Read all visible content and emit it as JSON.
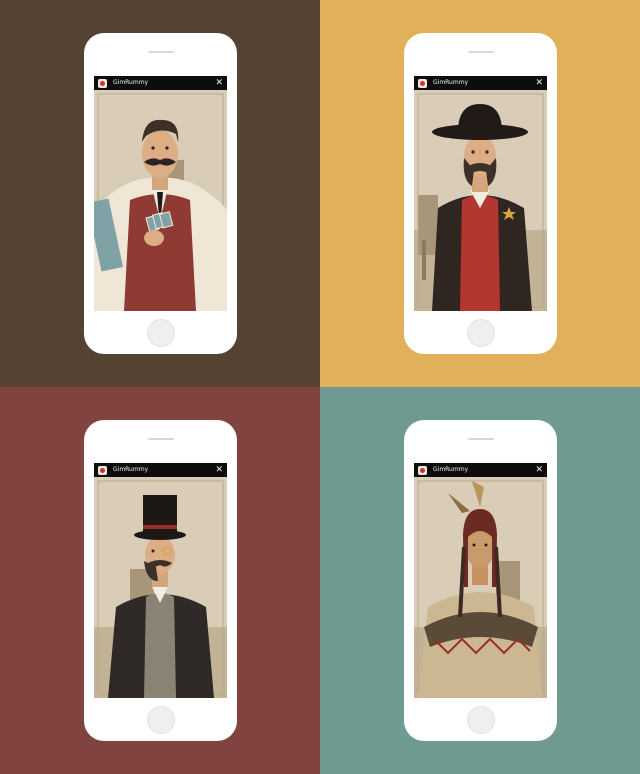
{
  "screens": [
    {
      "app_title": "GimRummy",
      "close_glyph": "✕",
      "character": "gambler",
      "background_color": "#544233"
    },
    {
      "app_title": "GimRummy",
      "close_glyph": "✕",
      "character": "sheriff",
      "background_color": "#e2b05a"
    },
    {
      "app_title": "GimRummy",
      "close_glyph": "✕",
      "character": "gentleman",
      "background_color": "#81433f"
    },
    {
      "app_title": "GimRummy",
      "close_glyph": "✕",
      "character": "chief",
      "background_color": "#6f9a91"
    }
  ],
  "icons": {
    "app": "gimrummy-app-icon",
    "close": "close-icon"
  }
}
